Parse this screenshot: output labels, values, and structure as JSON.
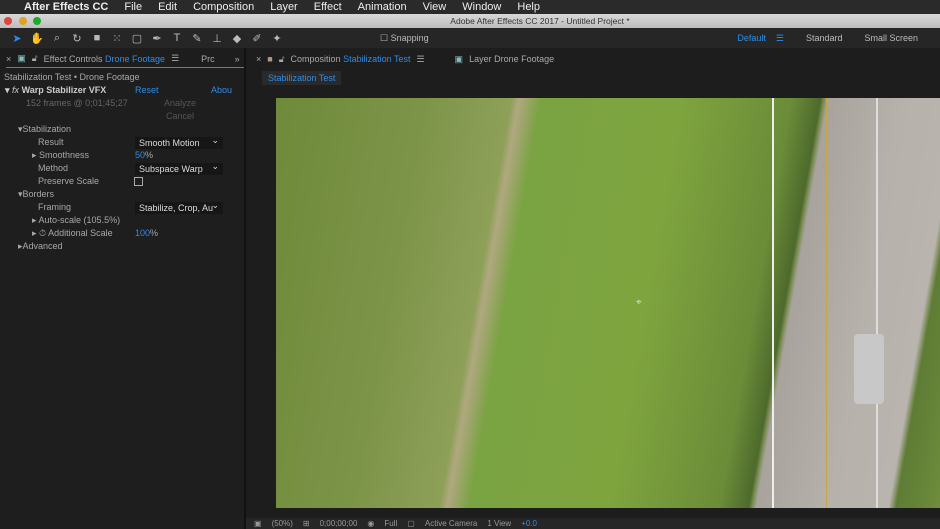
{
  "menubar": {
    "app": "After Effects CC",
    "items": [
      "File",
      "Edit",
      "Composition",
      "Layer",
      "Effect",
      "Animation",
      "View",
      "Window",
      "Help"
    ]
  },
  "window_title": "Adobe After Effects CC 2017 - Untitled Project *",
  "toolbar": {
    "snapping": "Snapping"
  },
  "workspaces": {
    "active": "Default",
    "items": [
      "Standard",
      "Small Screen"
    ]
  },
  "left_tabs": {
    "effect_controls": "Effect Controls",
    "layer": "Drone Footage",
    "project": "Prc"
  },
  "comp_tabs": {
    "composition": "Composition",
    "comp_name": "Stabilization Test",
    "layer_tab": "Layer Drone Footage",
    "subtab": "Stabilization Test"
  },
  "effect": {
    "breadcrumb": "Stabilization Test • Drone Footage",
    "name": "Warp Stabilizer VFX",
    "reset": "Reset",
    "about": "Abou",
    "frames": "152 frames @ 0;01;45;27",
    "analyze": "Analyze",
    "cancel": "Cancel",
    "stabilization": "Stabilization",
    "result_label": "Result",
    "result_value": "Smooth Motion",
    "smoothness_label": "Smoothness",
    "smoothness_value": "50",
    "method_label": "Method",
    "method_value": "Subspace Warp",
    "preserve_label": "Preserve Scale",
    "borders": "Borders",
    "framing_label": "Framing",
    "framing_value": "Stabilize, Crop, Au",
    "autoscale": "Auto-scale (105.5%)",
    "addscale_label": "Additional Scale",
    "addscale_value": "100",
    "advanced": "Advanced",
    "pct": "%"
  },
  "viewer_bar": {
    "zoom": "(50%)",
    "timecode": "0;00;00;00",
    "resolution": "Full",
    "camera": "Active Camera",
    "views": "1 View",
    "exposure": "+0.0"
  }
}
